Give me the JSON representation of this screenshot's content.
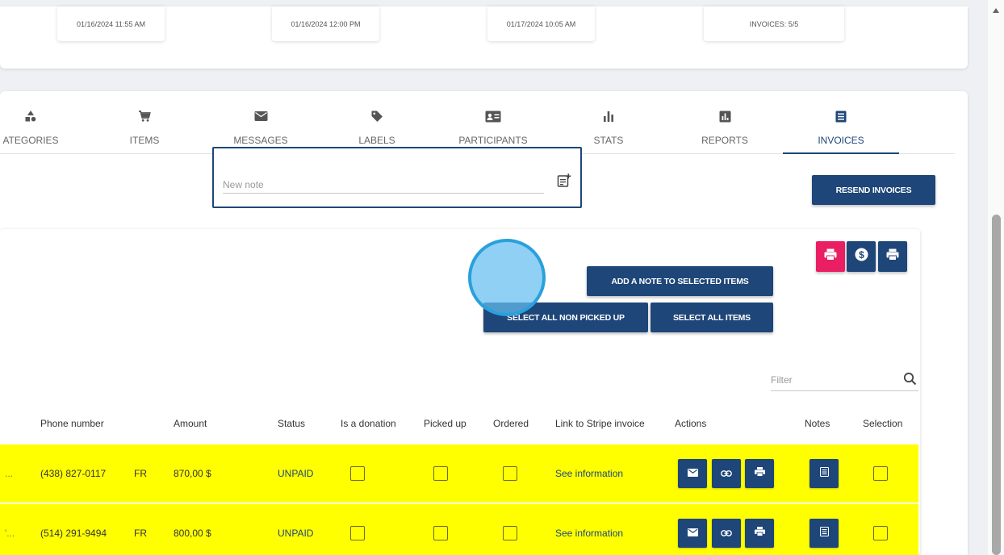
{
  "summary": [
    {
      "text": "01/16/2024 11:55 AM"
    },
    {
      "text": "01/16/2024 12:00 PM"
    },
    {
      "text": "01/17/2024 10:05 AM"
    },
    {
      "text": "INVOICES: 5/5"
    }
  ],
  "tabs": [
    {
      "label": "ATEGORIES",
      "icon": "categories-icon"
    },
    {
      "label": "ITEMS",
      "icon": "cart-icon"
    },
    {
      "label": "MESSAGES",
      "icon": "mail-icon"
    },
    {
      "label": "LABELS",
      "icon": "label-icon"
    },
    {
      "label": "PARTICIPANTS",
      "icon": "contact-card-icon"
    },
    {
      "label": "STATS",
      "icon": "bar-chart-icon"
    },
    {
      "label": "REPORTS",
      "icon": "report-icon"
    },
    {
      "label": "INVOICES",
      "icon": "invoice-icon",
      "active": true
    }
  ],
  "toolbar": {
    "resend_label": "RESEND INVOICES",
    "note_placeholder": "New note",
    "add_note_label": "ADD A NOTE TO SELECTED ITEMS",
    "select_non_picked_label": "SELECT ALL NON PICKED UP",
    "select_all_label": "SELECT ALL ITEMS",
    "filter_placeholder": "Filter"
  },
  "table": {
    "headers": [
      "Phone number",
      "Amount",
      "Status",
      "Is a donation",
      "Picked up",
      "Ordered",
      "Link to Stripe invoice",
      "Actions",
      "Notes",
      "Selection"
    ],
    "rows": [
      {
        "prefix": "...",
        "phone": "(438) 827-0117",
        "lang": "FR",
        "amount": "870,00 $",
        "status": "UNPAID",
        "link": "See information"
      },
      {
        "prefix": "'...",
        "phone": "(514) 291-9494",
        "lang": "FR",
        "amount": "800,00 $",
        "status": "UNPAID",
        "link": "See information"
      }
    ]
  },
  "colors": {
    "primary": "#1e4678",
    "pink": "#e91e63",
    "row_highlight": "#ffff00",
    "click_indicator": "#64bef0"
  }
}
